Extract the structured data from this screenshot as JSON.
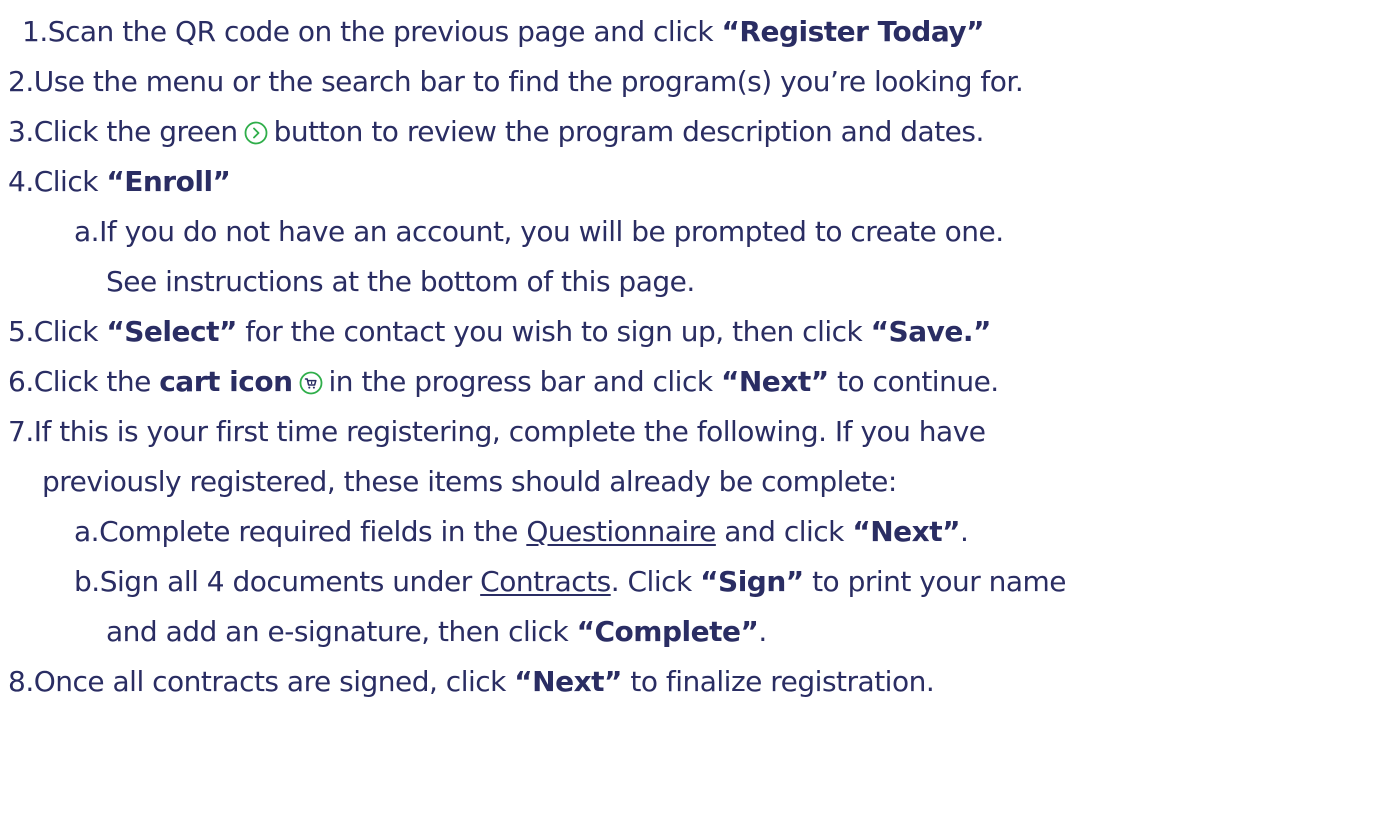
{
  "steps": [
    {
      "num": "1.",
      "pre": "Scan the QR code on the previous page and click ",
      "b1": "“Register Today”"
    },
    {
      "num": "2.",
      "pre": "Use the menu or the search bar to find the program(s) you’re looking for."
    },
    {
      "num": "3.",
      "pre": "Click the green",
      "post": "button to review the program description and dates."
    },
    {
      "num": "4.",
      "pre": "Click ",
      "b1": "“Enroll”"
    },
    {
      "num": "a.",
      "pre": "If you do not have an account, you will be prompted to create one."
    },
    {
      "num": "",
      "pre": "See instructions at the bottom of this page."
    },
    {
      "num": "5.",
      "pre": "Click ",
      "b1": "“Select”",
      "mid": " for the contact you wish to sign up, then click ",
      "b2": "“Save.”"
    },
    {
      "num": "6.",
      "pre": "Click the ",
      "b1": "cart icon",
      "post": "in the progress bar and click ",
      "b2": "“Next”",
      "end": " to continue."
    },
    {
      "num": "7.",
      "pre": "If this is your first time registering, complete the following. If you have"
    },
    {
      "num": "",
      "pre": "previously registered, these items should already be complete:"
    },
    {
      "num": "a.",
      "pre": "Complete required fields in the ",
      "u1": "Questionnaire",
      "mid": " and click ",
      "b1": "“Next”",
      "end": "."
    },
    {
      "num": "b.",
      "pre": "Sign all 4 documents under ",
      "u1": "Contracts",
      "mid": ". Click ",
      "b1": "“Sign”",
      "end": " to print your name"
    },
    {
      "num": "",
      "pre": "and add an e-signature, then click ",
      "b1": "“Complete”",
      "end": "."
    },
    {
      "num": "8.",
      "pre": "Once all contracts are signed, click ",
      "b1": "“Next”",
      "end": " to finalize registration."
    }
  ],
  "icons": {
    "step3": "green-chevron-right-circle-icon",
    "step6": "cart-icon"
  },
  "colors": {
    "text": "#2a2d63",
    "icon_green": "#2fae4a"
  }
}
